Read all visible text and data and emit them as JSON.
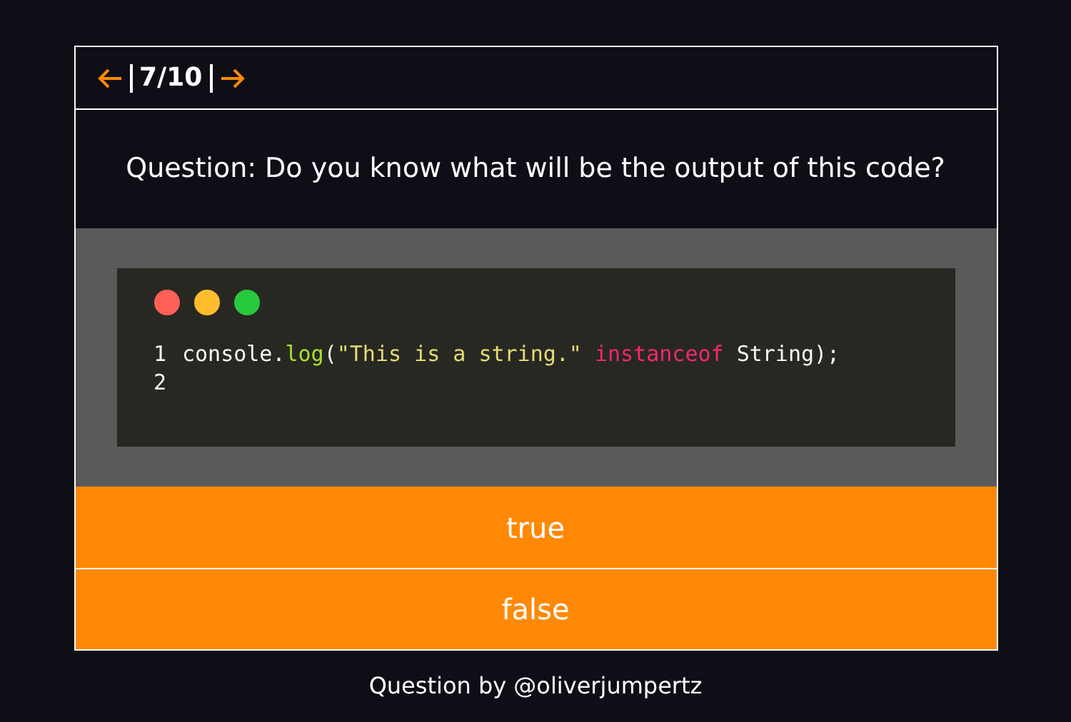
{
  "nav": {
    "counter": "7/10"
  },
  "question": "Question: Do you know what will be the output of this code?",
  "code": {
    "lines": [
      {
        "number": "1",
        "tokens": [
          {
            "kind": "plain",
            "text": "console."
          },
          {
            "kind": "function",
            "text": "log"
          },
          {
            "kind": "plain",
            "text": "("
          },
          {
            "kind": "string",
            "text": "\"This is a string.\""
          },
          {
            "kind": "keyword",
            "text": " instanceof"
          },
          {
            "kind": "plain",
            "text": " String);"
          }
        ]
      },
      {
        "number": "2"
      }
    ]
  },
  "answers": [
    {
      "label": "true"
    },
    {
      "label": "false"
    }
  ],
  "footer": "Question by @oliverjumpertz"
}
